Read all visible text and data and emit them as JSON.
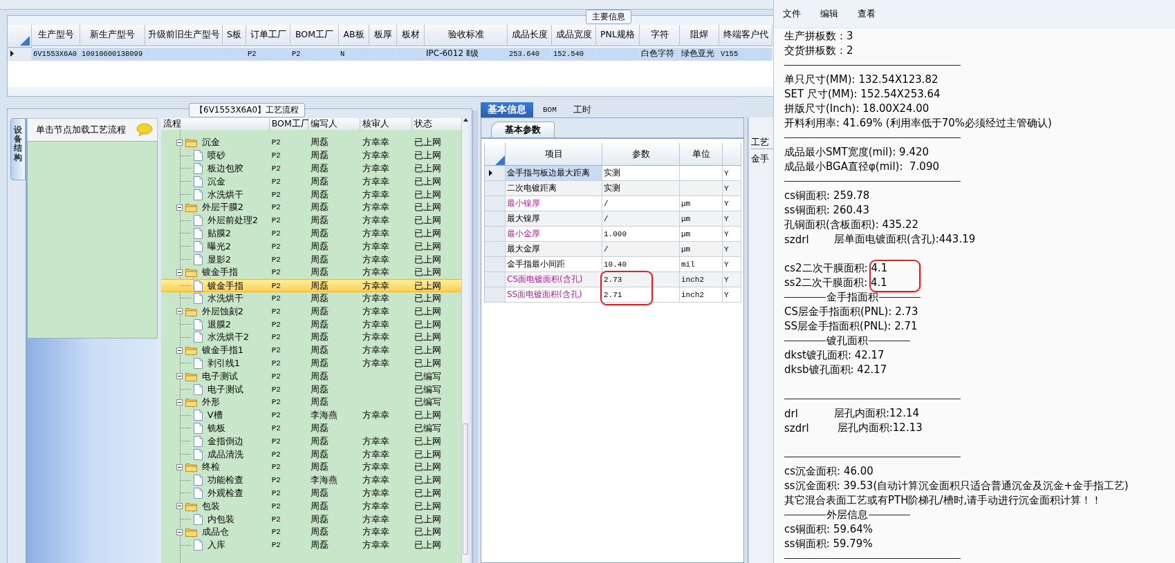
{
  "main_info": {
    "title": "主要信息",
    "columns": [
      "生产型号",
      "新生产型号",
      "升级前旧生产型号",
      "S板",
      "订单工厂",
      "BOM工厂",
      "AB板",
      "板厚",
      "板材",
      "验收标准",
      "成品长度",
      "成品宽度",
      "PNL规格",
      "字符",
      "阻焊",
      "终端客户代"
    ],
    "rows": [
      {
        "selected": true,
        "cells": [
          "6V1553X6A0",
          "10010600138099",
          "",
          "",
          "P2",
          "P2",
          "N",
          "",
          "",
          "IPC-6012 Ⅱ级",
          "253.640",
          "152.540",
          "",
          "白色字符",
          "绿色亚光",
          "V155"
        ]
      }
    ]
  },
  "process": {
    "title": "【6V1553X6A0】工艺流程",
    "side_tab": {
      "label": "设备结构",
      "selected": true
    },
    "hint": "单击节点加载工艺流程",
    "columns": [
      "流程",
      "BOM工厂",
      "编写人",
      "核审人",
      "状态"
    ],
    "nodes": [
      {
        "name": "沉金",
        "bom": "P2",
        "author": "周磊",
        "reviewer": "方幸幸",
        "status": "已上网",
        "selected": false,
        "expanded": true,
        "children": [
          {
            "name": "喷砂",
            "bom": "P2",
            "author": "周磊",
            "reviewer": "方幸幸",
            "status": "已上网",
            "selected": false
          },
          {
            "name": "板边包胶",
            "bom": "P2",
            "author": "周磊",
            "reviewer": "方幸幸",
            "status": "已上网",
            "selected": false
          },
          {
            "name": "沉金",
            "bom": "P2",
            "author": "周磊",
            "reviewer": "方幸幸",
            "status": "已上网",
            "selected": false
          },
          {
            "name": "水洗烘干",
            "bom": "P2",
            "author": "周磊",
            "reviewer": "方幸幸",
            "status": "已上网",
            "selected": false
          }
        ]
      },
      {
        "name": "外层干膜2",
        "bom": "P2",
        "author": "周磊",
        "reviewer": "方幸幸",
        "status": "已上网",
        "selected": false,
        "expanded": true,
        "children": [
          {
            "name": "外层前处理2",
            "bom": "P2",
            "author": "周磊",
            "reviewer": "方幸幸",
            "status": "已上网",
            "selected": false
          },
          {
            "name": "贴膜2",
            "bom": "P2",
            "author": "周磊",
            "reviewer": "方幸幸",
            "status": "已上网",
            "selected": false
          },
          {
            "name": "曝光2",
            "bom": "P2",
            "author": "周磊",
            "reviewer": "方幸幸",
            "status": "已上网",
            "selected": false
          },
          {
            "name": "显影2",
            "bom": "P2",
            "author": "周磊",
            "reviewer": "方幸幸",
            "status": "已上网",
            "selected": false
          }
        ]
      },
      {
        "name": "镀金手指",
        "bom": "P2",
        "author": "周磊",
        "reviewer": "方幸幸",
        "status": "已上网",
        "selected": false,
        "expanded": true,
        "children": [
          {
            "name": "镀金手指",
            "bom": "P2",
            "author": "周磊",
            "reviewer": "方幸幸",
            "status": "已上网",
            "selected": true
          },
          {
            "name": "水洗烘干",
            "bom": "P2",
            "author": "周磊",
            "reviewer": "方幸幸",
            "status": "已上网",
            "selected": false
          }
        ]
      },
      {
        "name": "外层蚀刻2",
        "bom": "P2",
        "author": "周磊",
        "reviewer": "方幸幸",
        "status": "已上网",
        "selected": false,
        "expanded": true,
        "children": [
          {
            "name": "退膜2",
            "bom": "P2",
            "author": "周磊",
            "reviewer": "方幸幸",
            "status": "已上网",
            "selected": false
          },
          {
            "name": "水洗烘干2",
            "bom": "P2",
            "author": "周磊",
            "reviewer": "方幸幸",
            "status": "已上网",
            "selected": false
          }
        ]
      },
      {
        "name": "镀金手指1",
        "bom": "P2",
        "author": "周磊",
        "reviewer": "方幸幸",
        "status": "已上网",
        "selected": false,
        "expanded": true,
        "children": [
          {
            "name": "剥引线1",
            "bom": "P2",
            "author": "周磊",
            "reviewer": "方幸幸",
            "status": "已上网",
            "selected": false
          }
        ]
      },
      {
        "name": "电子测试",
        "bom": "P2",
        "author": "周磊",
        "status": "已编写",
        "selected": false,
        "expanded": true,
        "children": [
          {
            "name": "电子测试",
            "bom": "P2",
            "author": "周磊",
            "status": "已编写",
            "selected": false
          }
        ]
      },
      {
        "name": "外形",
        "bom": "P2",
        "author": "周磊",
        "status": "已编写",
        "selected": false,
        "expanded": true,
        "children": [
          {
            "name": "V槽",
            "bom": "P2",
            "author": "李海燕",
            "reviewer": "方幸幸",
            "status": "已上网",
            "selected": false
          },
          {
            "name": "铣板",
            "bom": "P2",
            "author": "周磊",
            "status": "已编写",
            "selected": false
          },
          {
            "name": "金指倒边",
            "bom": "P2",
            "author": "周磊",
            "reviewer": "方幸幸",
            "status": "已上网",
            "selected": false
          },
          {
            "name": "成品清洗",
            "bom": "P2",
            "author": "周磊",
            "reviewer": "方幸幸",
            "status": "已上网",
            "selected": false
          }
        ]
      },
      {
        "name": "终检",
        "bom": "P2",
        "author": "周磊",
        "reviewer": "方幸幸",
        "status": "已上网",
        "selected": false,
        "expanded": true,
        "children": [
          {
            "name": "功能检查",
            "bom": "P2",
            "author": "李海燕",
            "reviewer": "方幸幸",
            "status": "已上网",
            "selected": false
          },
          {
            "name": "外观检查",
            "bom": "P2",
            "author": "周磊",
            "reviewer": "方幸幸",
            "status": "已上网",
            "selected": false
          }
        ]
      },
      {
        "name": "包装",
        "bom": "P2",
        "author": "周磊",
        "reviewer": "方幸幸",
        "status": "已上网",
        "selected": false,
        "expanded": true,
        "children": [
          {
            "name": "内包装",
            "bom": "P2",
            "author": "周磊",
            "reviewer": "方幸幸",
            "status": "已上网",
            "selected": false
          }
        ]
      },
      {
        "name": "成品仓",
        "bom": "P2",
        "author": "周磊",
        "reviewer": "方幸幸",
        "status": "已上网",
        "selected": false,
        "expanded": true,
        "children": [
          {
            "name": "入库",
            "bom": "P2",
            "author": "周磊",
            "reviewer": "方幸幸",
            "status": "已上网",
            "selected": false
          }
        ]
      }
    ]
  },
  "detail": {
    "tabs": [
      {
        "label": "基本信息",
        "selected": true
      },
      {
        "label": "BOM",
        "selected": false
      },
      {
        "label": "工时",
        "selected": false
      }
    ],
    "subtab": "基本参数",
    "columns": [
      "项目",
      "参数",
      "单位"
    ],
    "rows": [
      {
        "item": "金手指与板边最大距离",
        "value": "实测",
        "column_4": "Y",
        "highlight": false,
        "selected": true,
        "circled": false
      },
      {
        "item": "二次电镀距离",
        "value": "实测",
        "column_4": "Y",
        "highlight": false,
        "selected": false,
        "circled": false
      },
      {
        "item": "最小镍厚",
        "value": "/",
        "unit": "μm",
        "column_4": "Y",
        "highlight": true,
        "selected": false,
        "circled": false
      },
      {
        "item": "最大镍厚",
        "value": "/",
        "unit": "μm",
        "column_4": "Y",
        "highlight": false,
        "selected": false,
        "circled": false
      },
      {
        "item": "最小金厚",
        "value": "1.000",
        "unit": "μm",
        "column_4": "Y",
        "highlight": true,
        "selected": false,
        "circled": false
      },
      {
        "item": "最大金厚",
        "value": "/",
        "unit": "μm",
        "column_4": "Y",
        "highlight": false,
        "selected": false,
        "circled": false
      },
      {
        "item": "金手指最小间距",
        "value": "10.40",
        "unit": "mil",
        "column_4": "Y",
        "highlight": false,
        "selected": false,
        "circled": false
      },
      {
        "item": "CS面电镀面积(含孔)",
        "value": "2.73",
        "unit": "inch2",
        "column_4": "Y",
        "highlight": true,
        "selected": false,
        "circled": true
      },
      {
        "item": "SS面电镀面积(含孔)",
        "value": "2.71",
        "unit": "inch2",
        "column_4": "Y",
        "highlight": true,
        "selected": false,
        "circled": true
      }
    ]
  },
  "side_panel": {
    "tab": "工艺",
    "label": "金手"
  },
  "report": {
    "menu": [
      "文件",
      "编辑",
      "查看"
    ],
    "lines": [
      {
        "kind": "text",
        "text": "生产拼板数：3"
      },
      {
        "kind": "text",
        "text": "交货拼板数：2"
      },
      {
        "kind": "rule"
      },
      {
        "kind": "text",
        "text": "单只尺寸(MM): 132.54X123.82"
      },
      {
        "kind": "text",
        "text": "SET 尺寸(MM): 152.54X253.64"
      },
      {
        "kind": "text",
        "text": "拼版尺寸(Inch): 18.00X24.00"
      },
      {
        "kind": "text",
        "text": "开料利用率: 41.69% (利用率低于70%必须经过主管确认)"
      },
      {
        "kind": "rule"
      },
      {
        "kind": "text",
        "text": "成品最小SMT宽度(mil): 9.420"
      },
      {
        "kind": "text",
        "text": "成品最小BGA直径φ(mil):  7.090"
      },
      {
        "kind": "rule"
      },
      {
        "kind": "text",
        "text": "cs铜面积: 259.78"
      },
      {
        "kind": "text",
        "text": "ss铜面积: 260.43"
      },
      {
        "kind": "text",
        "text": "孔铜面积(含板面积): 435.22"
      },
      {
        "kind": "split",
        "left": "szdrl",
        "right": "层单面电镀面积(含孔):443.19"
      },
      {
        "kind": "blank"
      },
      {
        "kind": "text",
        "text": "cs2二次干膜面积: 4.1",
        "circled": true
      },
      {
        "kind": "text",
        "text": "ss2二次干膜面积: 4.1",
        "circled": true
      },
      {
        "kind": "titled_rule",
        "text": "金手指面积"
      },
      {
        "kind": "text",
        "text": "CS层金手指面积(PNL): 2.73"
      },
      {
        "kind": "text",
        "text": "SS层金手指面积(PNL): 2.71"
      },
      {
        "kind": "titled_rule",
        "text": "镀孔面积"
      },
      {
        "kind": "text",
        "text": "dkst镀孔面积: 42.17"
      },
      {
        "kind": "text",
        "text": "dksb镀孔面积: 42.17"
      },
      {
        "kind": "blank"
      },
      {
        "kind": "rule"
      },
      {
        "kind": "split",
        "left": "drl",
        "right": "层孔内面积:12.14"
      },
      {
        "kind": "split",
        "left": "szdrl",
        "right": " 层孔内面积:12.13"
      },
      {
        "kind": "blank"
      },
      {
        "kind": "rule"
      },
      {
        "kind": "text",
        "text": "cs沉金面积: 46.00"
      },
      {
        "kind": "text",
        "text": "ss沉金面积: 39.53(自动计算沉金面积只适合普通沉金及沉金+金手指工艺)"
      },
      {
        "kind": "text",
        "text": "其它混合表面工艺或有PTH阶梯孔/槽时,请手动进行沉金面积计算！！"
      },
      {
        "kind": "titled_rule",
        "text": "外层信息"
      },
      {
        "kind": "text",
        "text": "cs铜面积: 59.64%"
      },
      {
        "kind": "text",
        "text": "ss铜面积: 59.79%"
      },
      {
        "kind": "rule"
      }
    ]
  }
}
